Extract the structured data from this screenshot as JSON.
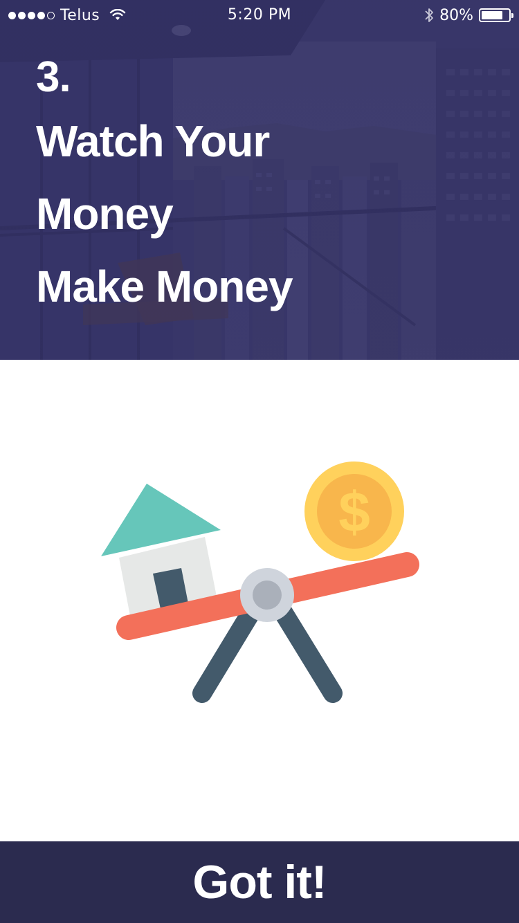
{
  "status_bar": {
    "signal_bars_filled": 4,
    "signal_bars_total": 5,
    "carrier": "Telus",
    "wifi_icon": "wifi-icon",
    "time": "5:20 PM",
    "bluetooth_icon": "bluetooth-icon",
    "battery_percent_label": "80%",
    "battery_level": 0.8
  },
  "onboarding": {
    "step_number": "3.",
    "title_lines": [
      "Watch Your",
      "Money",
      "Make Money"
    ],
    "background": "city-balcony-photo",
    "overlay_color": "#343266"
  },
  "illustration": {
    "name": "house-coin-seesaw",
    "icons": [
      "house-icon",
      "dollar-coin-icon",
      "seesaw-icon"
    ],
    "colors": {
      "roof": "#66c6ba",
      "house_wall": "#e6e8e7",
      "door": "#435a6b",
      "plank": "#f3705a",
      "pivot_outer": "#cfd4dc",
      "pivot_inner": "#aab0ba",
      "legs": "#435a6b",
      "coin_outer": "#ffd15c",
      "coin_inner": "#f8b64c",
      "coin_symbol": "#ffd15c"
    }
  },
  "footer": {
    "button_label": "Got it!",
    "button_color": "#2b2b4f"
  }
}
